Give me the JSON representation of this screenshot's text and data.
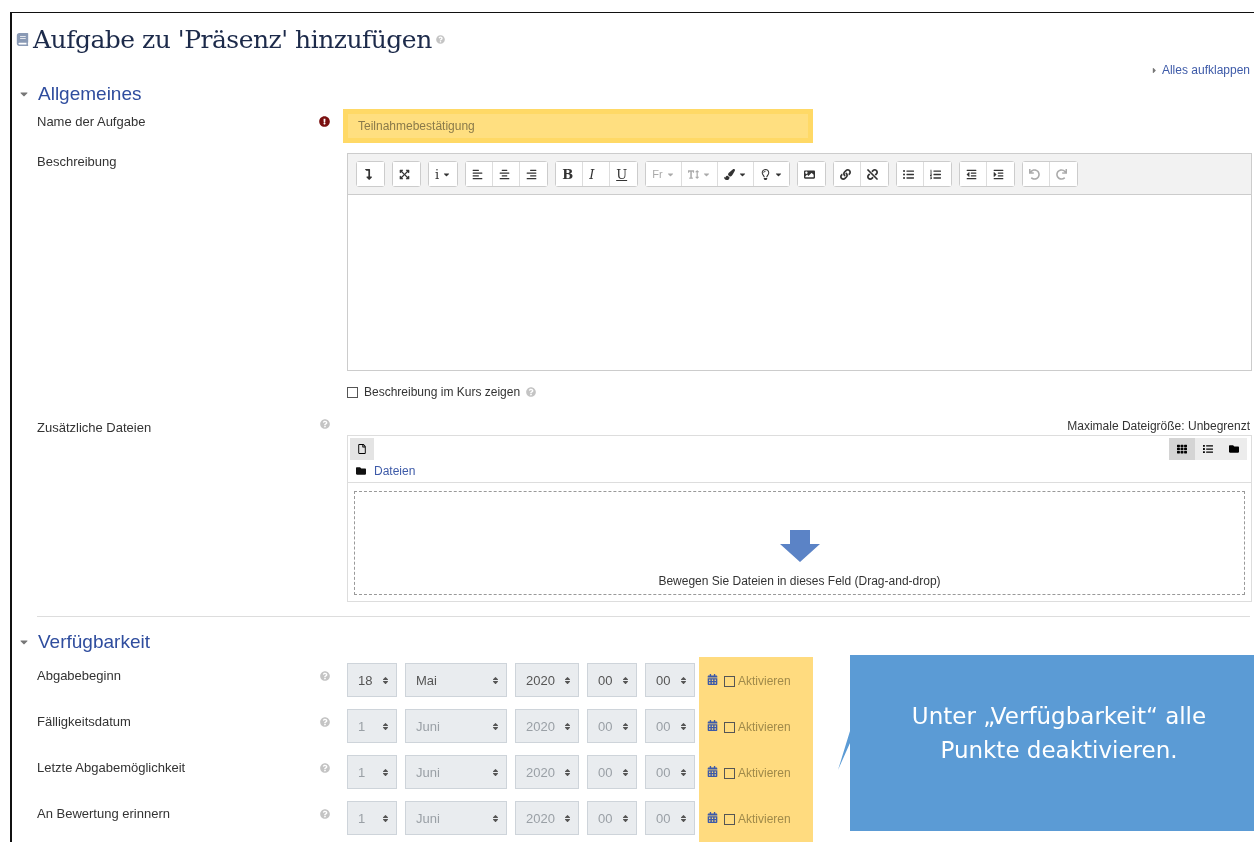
{
  "page_title": "Aufgabe zu 'Präsenz' hinzufügen",
  "expand_all": "Alles aufklappen",
  "sections": [
    {
      "title": "Allgemeines",
      "expanded": true
    },
    {
      "title": "Verfügbarkeit",
      "expanded": true
    }
  ],
  "name_field": {
    "label": "Name der Aufgabe",
    "required": true,
    "value": "Teilnahmebestätigung",
    "highlighted": true
  },
  "description": {
    "label": "Beschreibung",
    "toolbar": [
      [
        {
          "kind": "collapse",
          "disabled": false
        }
      ],
      [
        {
          "kind": "fullscreen",
          "disabled": false
        }
      ],
      [
        {
          "kind": "style",
          "label": "i",
          "dropdown": true,
          "disabled": false
        }
      ],
      [
        {
          "kind": "align-left",
          "disabled": false
        },
        {
          "kind": "align-center",
          "disabled": false
        },
        {
          "kind": "align-right",
          "disabled": false
        }
      ],
      [
        {
          "kind": "bold",
          "label": "B",
          "disabled": false
        },
        {
          "kind": "italic",
          "label": "I",
          "disabled": false
        },
        {
          "kind": "underline",
          "label": "U",
          "disabled": false
        }
      ],
      [
        {
          "kind": "text",
          "label": "Fr",
          "dropdown": true,
          "disabled": true
        },
        {
          "kind": "size",
          "dropdown": true,
          "disabled": true
        },
        {
          "kind": "brush",
          "dropdown": true,
          "disabled": false
        },
        {
          "kind": "bulb",
          "dropdown": true,
          "disabled": false
        }
      ],
      [
        {
          "kind": "image",
          "disabled": false
        }
      ],
      [
        {
          "kind": "link",
          "disabled": false
        },
        {
          "kind": "unlink",
          "disabled": false
        }
      ],
      [
        {
          "kind": "bullets",
          "disabled": false
        },
        {
          "kind": "numbers",
          "disabled": false
        }
      ],
      [
        {
          "kind": "outdent",
          "disabled": false
        },
        {
          "kind": "indent",
          "disabled": false
        }
      ],
      [
        {
          "kind": "undo",
          "disabled": true
        },
        {
          "kind": "redo",
          "disabled": true
        }
      ]
    ],
    "show_in_course": {
      "label": "Beschreibung im Kurs zeigen",
      "checked": false
    }
  },
  "files": {
    "label": "Zusätzliche Dateien",
    "max_size": "Maximale Dateigröße: Unbegrenzt",
    "folder": "Dateien",
    "drop_hint": "Bewegen Sie Dateien in dieses Feld (Drag-and-drop)",
    "views": [
      {
        "kind": "icons",
        "selected": true
      },
      {
        "kind": "list",
        "selected": false
      },
      {
        "kind": "tree",
        "selected": false
      }
    ]
  },
  "dates": [
    {
      "label": "Abgabebeginn",
      "day": "18",
      "month": "Mai",
      "year": "2020",
      "hour": "00",
      "minute": "00",
      "disabled": false,
      "enable_label": "Aktivieren",
      "enabled": false
    },
    {
      "label": "Fälligkeitsdatum",
      "day": "1",
      "month": "Juni",
      "year": "2020",
      "hour": "00",
      "minute": "00",
      "disabled": true,
      "enable_label": "Aktivieren",
      "enabled": false
    },
    {
      "label": "Letzte Abgabemöglichkeit",
      "day": "1",
      "month": "Juni",
      "year": "2020",
      "hour": "00",
      "minute": "00",
      "disabled": true,
      "enable_label": "Aktivieren",
      "enabled": false
    },
    {
      "label": "An Bewertung erinnern",
      "day": "1",
      "month": "Juni",
      "year": "2020",
      "hour": "00",
      "minute": "00",
      "disabled": true,
      "enable_label": "Aktivieren",
      "enabled": false
    }
  ],
  "enable_column_highlighted": true,
  "callout": {
    "text": "Unter „Verfügbarkeit“ alle Punkte deaktivieren."
  }
}
